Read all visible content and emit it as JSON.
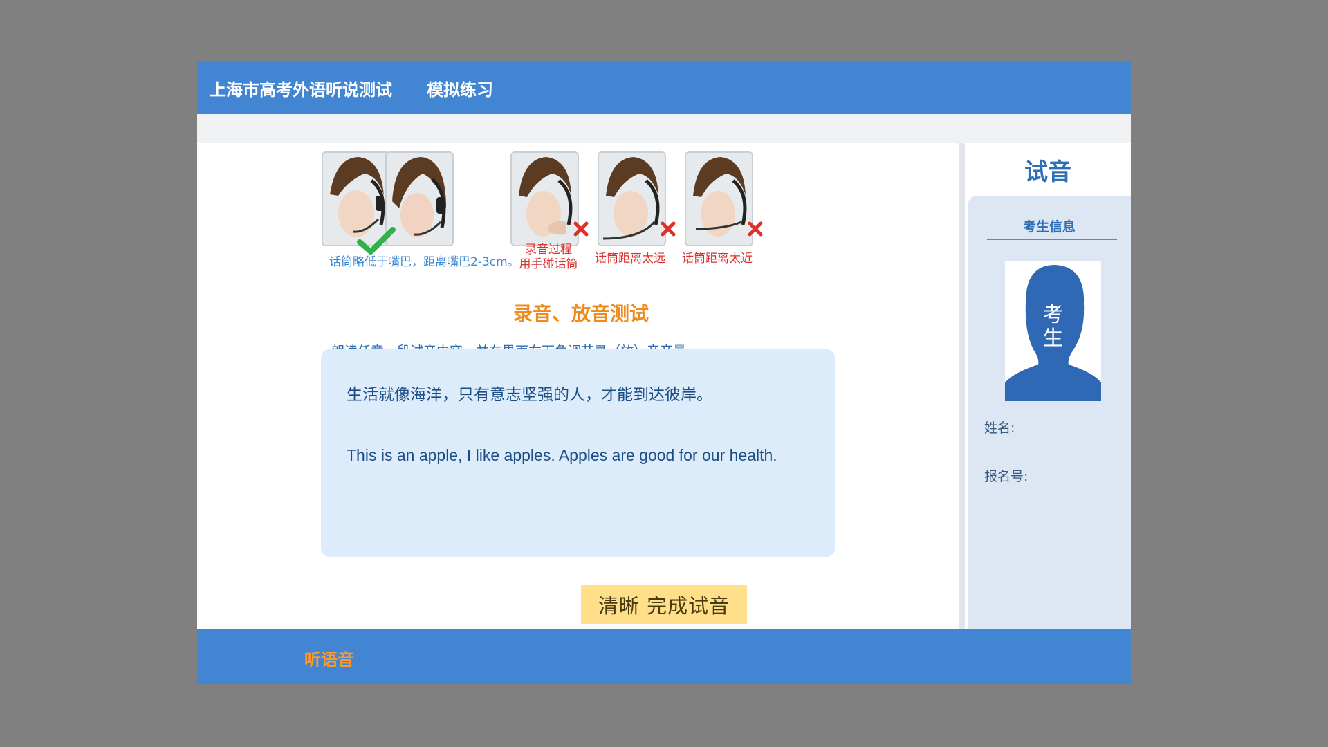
{
  "header": {
    "title": "上海市高考外语听说测试",
    "mode": "模拟练习"
  },
  "guide": {
    "correct_caption": "话筒略低于嘴巴，距离嘴巴2-3cm。",
    "wrong_captions": [
      "录音过程\n用手碰话筒",
      "话筒距离太远",
      "话筒距离太近"
    ]
  },
  "test": {
    "heading": "录音、放音测试",
    "instruction": "朗读任意一段试音内容，并在界面右下角调节录（放）音音量。",
    "sample_cn": "生活就像海洋，只有意志坚强的人，才能到达彼岸。",
    "sample_en": "This is an apple, I like apples. Apples are good for our health."
  },
  "actions": {
    "finish_label": "清晰  完成试音"
  },
  "footer": {
    "listen_label": "听语音"
  },
  "sidebar": {
    "title": "试音",
    "info_label": "考生信息",
    "avatar_text": "考生",
    "name_label": "姓名:",
    "reg_label": "报名号:"
  },
  "colors": {
    "brand": "#4285d2",
    "accent": "#f08a1a",
    "error": "#d8322c",
    "ok": "#2fb24a",
    "button": "#ffdf8a"
  }
}
